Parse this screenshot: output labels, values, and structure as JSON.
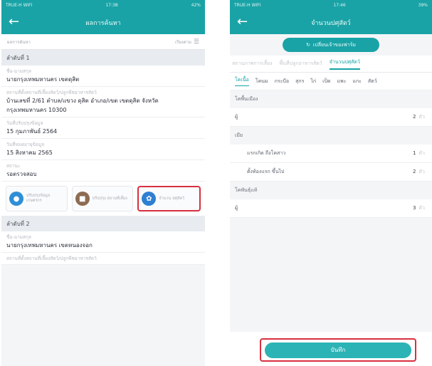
{
  "left": {
    "status": {
      "carrier": "TRUE-H WIFI",
      "time": "17:38",
      "battery": "42%"
    },
    "nav": {
      "title": "ผลการค้นหา"
    },
    "filter": {
      "label": "ผลการค้นหา",
      "sort_label": "เรียงตาม"
    },
    "records": [
      {
        "heading": "ลำดับที่ 1",
        "fields": [
          {
            "label": "ชื่อ-นามสกุล",
            "value": "นายกรุงเทพมหานคร เขตดุสิต"
          },
          {
            "label": "สถานที่ตั้งสถานที่เลี้ยงสัตว์/ปลูกพืชอาหารสัตว์",
            "value": "บ้านเลขที่ 2/61 ตำบล/แขวง ดุสิต อำเภอ/เขต เขตดุสิต จังหวัด กรุงเทพมหานคร 10300"
          },
          {
            "label": "วันที่ปรับปรุงข้อมูล",
            "value": "15 กุมภาพันธ์ 2564"
          },
          {
            "label": "วันที่หมดอายุข้อมูล",
            "value": "15 สิงหาคม 2565"
          },
          {
            "label": "สถานะ",
            "value": "รอตรวจสอบ"
          }
        ]
      },
      {
        "heading": "ลำดับที่ 2",
        "fields": [
          {
            "label": "ชื่อ-นามสกุล",
            "value": "นายกรุงเทพมหานคร เขตหนองจอก"
          },
          {
            "label": "สถานที่ตั้งสถานที่เลี้ยงสัตว์/ปลูกพืชอาหารสัตว์",
            "value": ""
          }
        ]
      }
    ],
    "actions": [
      {
        "label": "ปรับปรุงข้อมูล เกษตรกร",
        "icon": "user-icon",
        "color": "#2f8fd6"
      },
      {
        "label": "ปรับปรุง สถานที่เลี้ยง",
        "icon": "building-icon",
        "color": "#8c6c52"
      },
      {
        "label": "จำนวน ปศุสัตว์",
        "icon": "paw-icon",
        "color": "#2f7fd1"
      }
    ]
  },
  "right": {
    "status": {
      "carrier": "TRUE-H WIFI",
      "time": "17:46",
      "battery": "39%"
    },
    "nav": {
      "title": "จำนวนปศุสัตว์"
    },
    "switch_label": "เปลี่ยนเจ้าของฟาร์ม",
    "tabs": [
      "สถานภาพการเลี้ยง",
      "พื้นที่ปลูกอาหารสัตว์",
      "จำนวนปศุสัตว์"
    ],
    "chips": [
      "โคเนื้อ",
      "โคนม",
      "กระบือ",
      "สุกร",
      "ไก่",
      "เป็ด",
      "แพะ",
      "แกะ",
      "สัตว์"
    ],
    "groups": [
      {
        "title": "โคพื้นเมือง",
        "rows": [
          {
            "label": "ผู้",
            "count": "2",
            "unit": "ตัว",
            "indent": false
          },
          {
            "label": "เมีย",
            "count": "",
            "unit": "",
            "indent": false
          },
          {
            "label": "แรกเกิด ถึงโคสาว",
            "count": "1",
            "unit": "ตัว",
            "indent": true
          },
          {
            "label": "ตั้งท้องแรก ขึ้นไป",
            "count": "2",
            "unit": "ตัว",
            "indent": true
          }
        ]
      },
      {
        "title": "โคพันธุ์แท้",
        "rows": [
          {
            "label": "ผู้",
            "count": "3",
            "unit": "ตัว",
            "indent": false
          }
        ]
      }
    ],
    "save_label": "บันทึก"
  },
  "colors": {
    "primary": "#1aa3a6",
    "highlight": "#d7303f"
  }
}
